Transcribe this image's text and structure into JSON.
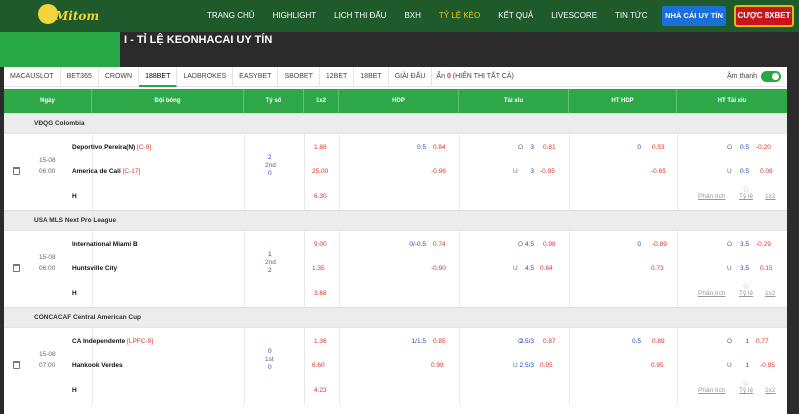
{
  "header": {
    "logo_text": "Mitom",
    "nav": [
      "TRANG CHỦ",
      "HIGHLIGHT",
      "LỊCH THI ĐẤU",
      "BXH",
      "TỶ LỆ KÈO",
      "KẾT QUẢ",
      "LIVESCORE",
      "TIN TỨC",
      "TUYỂN DỤNG"
    ],
    "active_nav": "TỶ LỆ KÈO",
    "btn_nhacai": "NHÀ CÁI UY TÍN",
    "btn_cuoc": "CƯỢC 8XBET"
  },
  "page_title": "I - TỈ LỆ KEONHACAI UY TÍN",
  "tabs": [
    "MACAUSLOT",
    "BET365",
    "CROWN",
    "188BET",
    "LADBROKES",
    "EASYBET",
    "SBOBET",
    "12BET",
    "18BET",
    "GIẢI ĐẤU"
  ],
  "active_tab": "188BET",
  "hide_label_pre": "Ẩn",
  "hide_count": "0",
  "hide_label_post": "(HIỂN THỊ TẤT CẢ)",
  "sound_label": "Âm thanh",
  "columns": [
    "Ngày",
    "Đội bóng",
    "Tỷ số",
    "1x2",
    "HDP",
    "Tài xỉu",
    "HT HDP",
    "HT Tài xỉu"
  ],
  "links": {
    "analysis": "Phân tích",
    "odds": "Tỷ lệ",
    "x12": "1x2"
  },
  "leagues": [
    {
      "name": "VĐQG Colombia",
      "date": "15-08",
      "time": "06:00",
      "home": {
        "name": "Deportivo Pereira(N)",
        "tag": "[C-9]",
        "score": "2",
        "x12": "1.88",
        "hdp_line": "0.5",
        "hdp_odds": "0.84",
        "ou_side": "O",
        "ou_line": "3",
        "ou_odds": "0.81",
        "ht_hdp_line": "0",
        "ht_hdp_odds": "0.53",
        "ht_ou_side": "O",
        "ht_ou_line": "0.5",
        "ht_ou_odds": "-0.20"
      },
      "status": "2nd",
      "away": {
        "name": "America de Cali",
        "tag": "[C-17]",
        "score": "0",
        "x12": "25.00",
        "hdp_line": "",
        "hdp_odds": "-0.96",
        "ou_side": "U",
        "ou_line": "3",
        "ou_odds": "-0.95",
        "ht_hdp_line": "",
        "ht_hdp_odds": "-0.65",
        "ht_ou_side": "U",
        "ht_ou_line": "0.5",
        "ht_ou_odds": "0.08"
      },
      "draw": {
        "label": "H",
        "x12": "6.30"
      }
    },
    {
      "name": "USA MLS Next Pro League",
      "date": "15-08",
      "time": "06:00",
      "home": {
        "name": "International Miami B",
        "tag": "",
        "score": "1",
        "x12": "9.00",
        "hdp_line": "0/-0.5",
        "hdp_odds": "0.74",
        "ou_side": "O",
        "ou_line": "4.5",
        "ou_odds": "0.98",
        "ht_hdp_line": "0",
        "ht_hdp_odds": "-0.89",
        "ht_ou_side": "O",
        "ht_ou_line": "3.5",
        "ht_ou_odds": "-0.29"
      },
      "status": "2nd",
      "away": {
        "name": "Huntsville City",
        "tag": "",
        "score": "2",
        "x12": "1.35",
        "hdp_line": "",
        "hdp_odds": "-0.90",
        "ou_side": "U",
        "ou_line": "4.5",
        "ou_odds": "0.84",
        "ht_hdp_line": "",
        "ht_hdp_odds": "0.73",
        "ht_ou_side": "U",
        "ht_ou_line": "3.5",
        "ht_ou_odds": "0.15"
      },
      "draw": {
        "label": "H",
        "x12": "3.68"
      }
    },
    {
      "name": "CONCACAF Central American Cup",
      "date": "15-08",
      "time": "07:00",
      "home": {
        "name": "CA Independente",
        "tag": "[LPFC-9]",
        "score": "0",
        "x12": "1.36",
        "hdp_line": "1/1.5",
        "hdp_odds": "0.85",
        "ou_side": "O",
        "ou_line": "2.5/3",
        "ou_odds": "0.87",
        "ht_hdp_line": "0.5",
        "ht_hdp_odds": "0.89",
        "ht_ou_side": "O",
        "ht_ou_line": "1",
        "ht_ou_odds": "0.77"
      },
      "status": "1st",
      "away": {
        "name": "Hankook Verdes",
        "tag": "",
        "score": "0",
        "x12": "6.60",
        "hdp_line": "",
        "hdp_odds": "0.99",
        "ou_side": "U",
        "ou_line": "2.5/3",
        "ou_odds": "0.95",
        "ht_hdp_line": "",
        "ht_hdp_odds": "0.95",
        "ht_ou_side": "U",
        "ht_ou_line": "1",
        "ht_ou_odds": "-0.95"
      },
      "draw": {
        "label": "H",
        "x12": "4.23"
      }
    }
  ]
}
